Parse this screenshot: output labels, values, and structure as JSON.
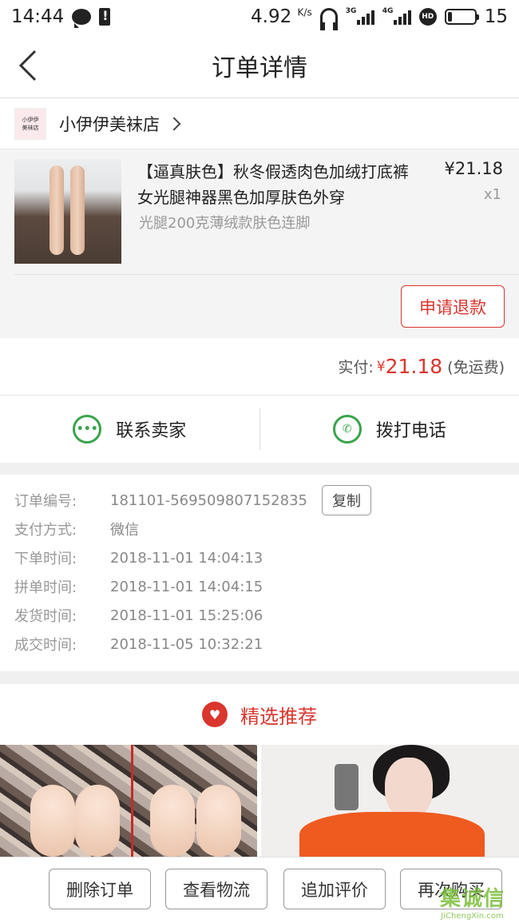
{
  "status_bar": {
    "time": "14:44",
    "speed": "4.92",
    "speed_unit": "K/s",
    "net1": "3G",
    "net2": "4G",
    "hd": "HD",
    "battery": "15"
  },
  "nav": {
    "title": "订单详情"
  },
  "shop": {
    "name": "小伊伊美袜店",
    "logo_line1": "小伊伊",
    "logo_line2": "美袜店"
  },
  "product": {
    "title": "【逼真肤色】秋冬假透肉色加绒打底裤女光腿神器黑色加厚肤色外穿",
    "variant": "光腿200克薄绒款肤色连脚",
    "price": "¥21.18",
    "qty": "x1",
    "refund_label": "申请退款"
  },
  "payment": {
    "label": "实付:",
    "currency": "¥",
    "amount": "21.18",
    "shipping": "(免运费)"
  },
  "contact": {
    "seller_label": "联系卖家",
    "phone_label": "拨打电话"
  },
  "order_info": {
    "copy_label": "复制",
    "rows": [
      {
        "key": "订单编号:",
        "value": "181101-569509807152835"
      },
      {
        "key": "支付方式:",
        "value": "微信"
      },
      {
        "key": "下单时间:",
        "value": "2018-11-01 14:04:13"
      },
      {
        "key": "拼单时间:",
        "value": "2018-11-01 14:04:15"
      },
      {
        "key": "发货时间:",
        "value": "2018-11-01 15:25:06"
      },
      {
        "key": "成交时间:",
        "value": "2018-11-05 10:32:21"
      }
    ]
  },
  "recommend": {
    "label": "精选推荐"
  },
  "actions": {
    "delete": "删除订单",
    "logistics": "查看物流",
    "review": "追加评价",
    "rebuy": "再次购买"
  },
  "watermark": {
    "main": "集诚信",
    "sub": "JiChengXin.com"
  },
  "colors": {
    "accent": "#d9362e",
    "green": "#3aa34b"
  }
}
